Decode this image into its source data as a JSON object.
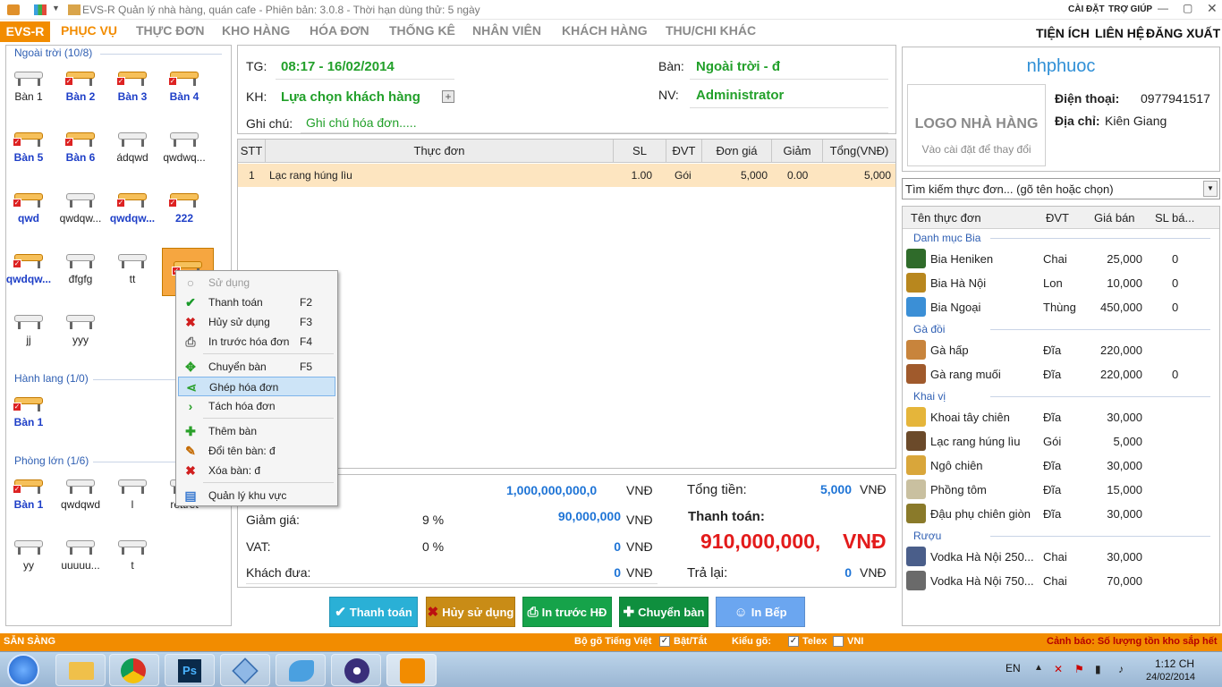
{
  "titlebar": {
    "title": "EVS-R Quản lý nhà hàng, quán cafe - Phiên bản: 3.0.8 - Thời hạn dùng thử: 5 ngày",
    "settings": "CÀI ĐẶT",
    "help": "TRỢ GIÚP"
  },
  "menu": {
    "brand": "EVS-R",
    "tabs": [
      "PHỤC VỤ",
      "THỰC ĐƠN",
      "KHO HÀNG",
      "HÓA ĐƠN",
      "THỐNG KÊ",
      "NHÂN VIÊN",
      "KHÁCH HÀNG",
      "THU/CHI KHÁC"
    ],
    "right": [
      "TIỆN ÍCH",
      "LIÊN HỆ",
      "ĐĂNG XUẤT"
    ]
  },
  "areas": [
    {
      "name": "Ngoài trời (10/8)",
      "tables": [
        {
          "label": "Bàn 1",
          "busy": false
        },
        {
          "label": "Bàn 2",
          "busy": true
        },
        {
          "label": "Bàn 3",
          "busy": true
        },
        {
          "label": "Bàn 4",
          "busy": true
        },
        {
          "label": "Bàn 5",
          "busy": true
        },
        {
          "label": "Bàn 6",
          "busy": true
        },
        {
          "label": "ádqwd",
          "busy": false
        },
        {
          "label": "qwdwq...",
          "busy": false
        },
        {
          "label": "qwd",
          "busy": true
        },
        {
          "label": "qwdqw...",
          "busy": false
        },
        {
          "label": "qwdqw...",
          "busy": true
        },
        {
          "label": "222",
          "busy": true
        },
        {
          "label": "qwdqw...",
          "busy": true
        },
        {
          "label": "đfgfg",
          "busy": false
        },
        {
          "label": "tt",
          "busy": false
        },
        {
          "label": "đ",
          "busy": true
        },
        {
          "label": "jj",
          "busy": false
        },
        {
          "label": "yyy",
          "busy": false
        }
      ]
    },
    {
      "name": "Hành lang (1/0)",
      "tables": [
        {
          "label": "Bàn 1",
          "busy": true
        }
      ]
    },
    {
      "name": "Phòng lớn (1/6)",
      "tables": [
        {
          "label": "Bàn 1",
          "busy": true
        },
        {
          "label": "qwdqwd",
          "busy": false
        },
        {
          "label": "l",
          "busy": false
        },
        {
          "label": "rếttrết",
          "busy": false
        },
        {
          "label": "yy",
          "busy": false
        },
        {
          "label": "uuuuu...",
          "busy": false
        },
        {
          "label": "t",
          "busy": false
        }
      ]
    }
  ],
  "info": {
    "time_label": "TG:",
    "time": "08:17 - 16/02/2014",
    "table_label": "Bàn:",
    "table": "Ngoài trời - đ",
    "customer_label": "KH:",
    "customer": "Lựa chọn khách hàng",
    "staff_label": "NV:",
    "staff": "Administrator",
    "note_label": "Ghi chú:",
    "note_placeholder": "Ghi chú hóa đơn....."
  },
  "grid": {
    "headers": [
      "STT",
      "Thực đơn",
      "SL",
      "ĐVT",
      "Đơn giá",
      "Giảm",
      "Tổng(VNĐ)"
    ],
    "rows": [
      {
        "stt": "1",
        "item": "Lạc rang húng lìu",
        "qty": "1.00",
        "unit": "Gói",
        "price": "5,000",
        "discount": "0.00",
        "total": "5,000"
      }
    ]
  },
  "totals": {
    "top_value": "1,000,000,000,0",
    "discount_label": "Giảm giá:",
    "discount_pct": "9 %",
    "discount_value": "90,000,000",
    "vat_label": "VAT:",
    "vat_pct": "0 %",
    "vat_value": "0",
    "paid_label": "Khách đưa:",
    "paid_value": "0",
    "currency": "VNĐ",
    "sum_label": "Tổng tiền:",
    "sum_value": "5,000",
    "pay_label": "Thanh toán:",
    "pay_value": "910,000,000,",
    "pay_currency": "VNĐ",
    "change_label": "Trả lại:",
    "change_value": "0"
  },
  "buttons": {
    "pay": "Thanh toán",
    "cancel": "Hủy sử dụng",
    "print": "In trước HĐ",
    "move": "Chuyển bàn",
    "kitchen": "In Bếp"
  },
  "restaurant": {
    "name": "nhphuoc",
    "logo_title": "LOGO NHÀ HÀNG",
    "logo_hint": "Vào cài đặt để thay đổi",
    "phone_label": "Điện thoại:",
    "phone": "0977941517",
    "address_label": "Địa chỉ:",
    "address": "Kiên Giang"
  },
  "search": {
    "placeholder": "Tìm kiếm thực đơn... (gõ tên hoặc chọn)"
  },
  "menu_list": {
    "headers": [
      "Tên thực đơn",
      "ĐVT",
      "Giá bán",
      "SL bá..."
    ],
    "categories": [
      {
        "name": "Danh mục Bia",
        "items": [
          {
            "name": "Bia Heniken",
            "unit": "Chai",
            "price": "25,000",
            "sold": "0",
            "color": "#2f6b2a"
          },
          {
            "name": "Bia Hà Nội",
            "unit": "Lon",
            "price": "10,000",
            "sold": "0",
            "color": "#b8871e"
          },
          {
            "name": "Bia Ngoại",
            "unit": "Thùng",
            "price": "450,000",
            "sold": "0",
            "color": "#3b8fd6"
          }
        ]
      },
      {
        "name": "Gà đồi",
        "items": [
          {
            "name": "Gà hấp",
            "unit": "Đĩa",
            "price": "220,000",
            "sold": "",
            "color": "#c8843c"
          },
          {
            "name": "Gà rang muối",
            "unit": "Đĩa",
            "price": "220,000",
            "sold": "0",
            "color": "#a05a2c"
          }
        ]
      },
      {
        "name": "Khai vị",
        "items": [
          {
            "name": "Khoai tây chiên",
            "unit": "Đĩa",
            "price": "30,000",
            "sold": "",
            "color": "#e5b53a"
          },
          {
            "name": "Lạc rang húng lìu",
            "unit": "Gói",
            "price": "5,000",
            "sold": "",
            "color": "#6b4a2a"
          },
          {
            "name": "Ngô chiên",
            "unit": "Đĩa",
            "price": "30,000",
            "sold": "",
            "color": "#d9a63a"
          },
          {
            "name": "Phồng tôm",
            "unit": "Đĩa",
            "price": "15,000",
            "sold": "",
            "color": "#c9c0a0"
          },
          {
            "name": "Đậu phụ chiên giòn",
            "unit": "Đĩa",
            "price": "30,000",
            "sold": "",
            "color": "#8a7a2a"
          }
        ]
      },
      {
        "name": "Rượu",
        "items": [
          {
            "name": "Vodka Hà Nội 250...",
            "unit": "Chai",
            "price": "30,000",
            "sold": "",
            "color": "#4a5e8a"
          },
          {
            "name": "Vodka Hà Nội 750...",
            "unit": "Chai",
            "price": "70,000",
            "sold": "",
            "color": "#6a6a6a"
          }
        ]
      }
    ]
  },
  "context_menu": [
    {
      "label": "Sử dụng",
      "key": "",
      "icon": "use-icon",
      "disabled": true
    },
    {
      "label": "Thanh toán",
      "key": "F2",
      "icon": "check-icon"
    },
    {
      "label": "Hủy sử dụng",
      "key": "F3",
      "icon": "cross-icon"
    },
    {
      "label": "In trước hóa đơn",
      "key": "F4",
      "icon": "printer-icon"
    },
    {
      "label": "Chuyển bàn",
      "key": "F5",
      "icon": "move-icon"
    },
    {
      "label": "Ghép hóa đơn",
      "key": "",
      "icon": "merge-icon",
      "highlighted": true
    },
    {
      "label": "Tách hóa đơn",
      "key": "",
      "icon": "split-icon"
    },
    {
      "label": "Thêm bàn",
      "key": "",
      "icon": "plus-icon"
    },
    {
      "label": "Đổi tên bàn: đ",
      "key": "",
      "icon": "pencil-icon"
    },
    {
      "label": "Xóa bàn: đ",
      "key": "",
      "icon": "delete-icon"
    },
    {
      "label": "Quản lý khu vực",
      "key": "",
      "icon": "area-icon"
    }
  ],
  "status": {
    "ready": "SẴN SÀNG",
    "ime_label": "Bộ gõ Tiếng Việt",
    "onoff": "Bật/Tắt",
    "style_label": "Kiểu gõ:",
    "telex": "Telex",
    "vni": "VNI",
    "warning": "Cảnh báo: Số lượng tồn kho sắp hết"
  },
  "taskbar": {
    "lang": "EN",
    "time": "1:12 CH",
    "date": "24/02/2014"
  },
  "colors": {
    "accent": "#f28c00",
    "green": "#22a02a",
    "blue": "#1e74d6",
    "red": "#e31b1b"
  }
}
